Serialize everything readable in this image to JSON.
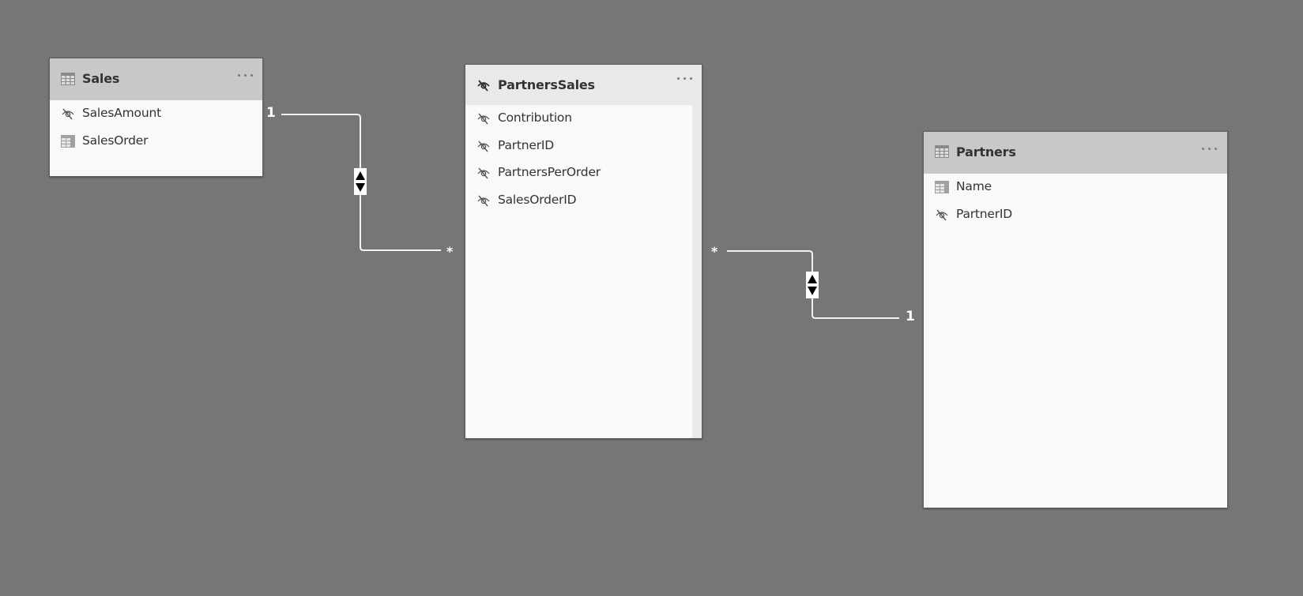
{
  "canvas": {
    "background_color": "#767676"
  },
  "tables": {
    "sales": {
      "name": "Sales",
      "icon": "table-icon",
      "more_label": "More options",
      "fields": [
        {
          "name": "SalesAmount",
          "icon": "hidden-eye-icon"
        },
        {
          "name": "SalesOrder",
          "icon": "column-table-icon"
        }
      ]
    },
    "partners_sales": {
      "name": "PartnersSales",
      "icon": "hidden-eye-icon",
      "selected": true,
      "more_label": "More options",
      "fields": [
        {
          "name": "Contribution",
          "icon": "hidden-eye-icon"
        },
        {
          "name": "PartnerID",
          "icon": "hidden-eye-icon"
        },
        {
          "name": "PartnersPerOrder",
          "icon": "hidden-eye-icon"
        },
        {
          "name": "SalesOrderID",
          "icon": "hidden-eye-icon"
        }
      ]
    },
    "partners": {
      "name": "Partners",
      "icon": "table-icon",
      "more_label": "More options",
      "fields": [
        {
          "name": "Name",
          "icon": "column-table-icon"
        },
        {
          "name": "PartnerID",
          "icon": "hidden-eye-icon"
        }
      ]
    }
  },
  "relationships": [
    {
      "from_table": "Sales",
      "to_table": "PartnersSales",
      "from_cardinality": "1",
      "to_cardinality": "*",
      "cross_filter": "both"
    },
    {
      "from_table": "PartnersSales",
      "to_table": "Partners",
      "from_cardinality": "*",
      "to_cardinality": "1",
      "cross_filter": "both"
    }
  ]
}
